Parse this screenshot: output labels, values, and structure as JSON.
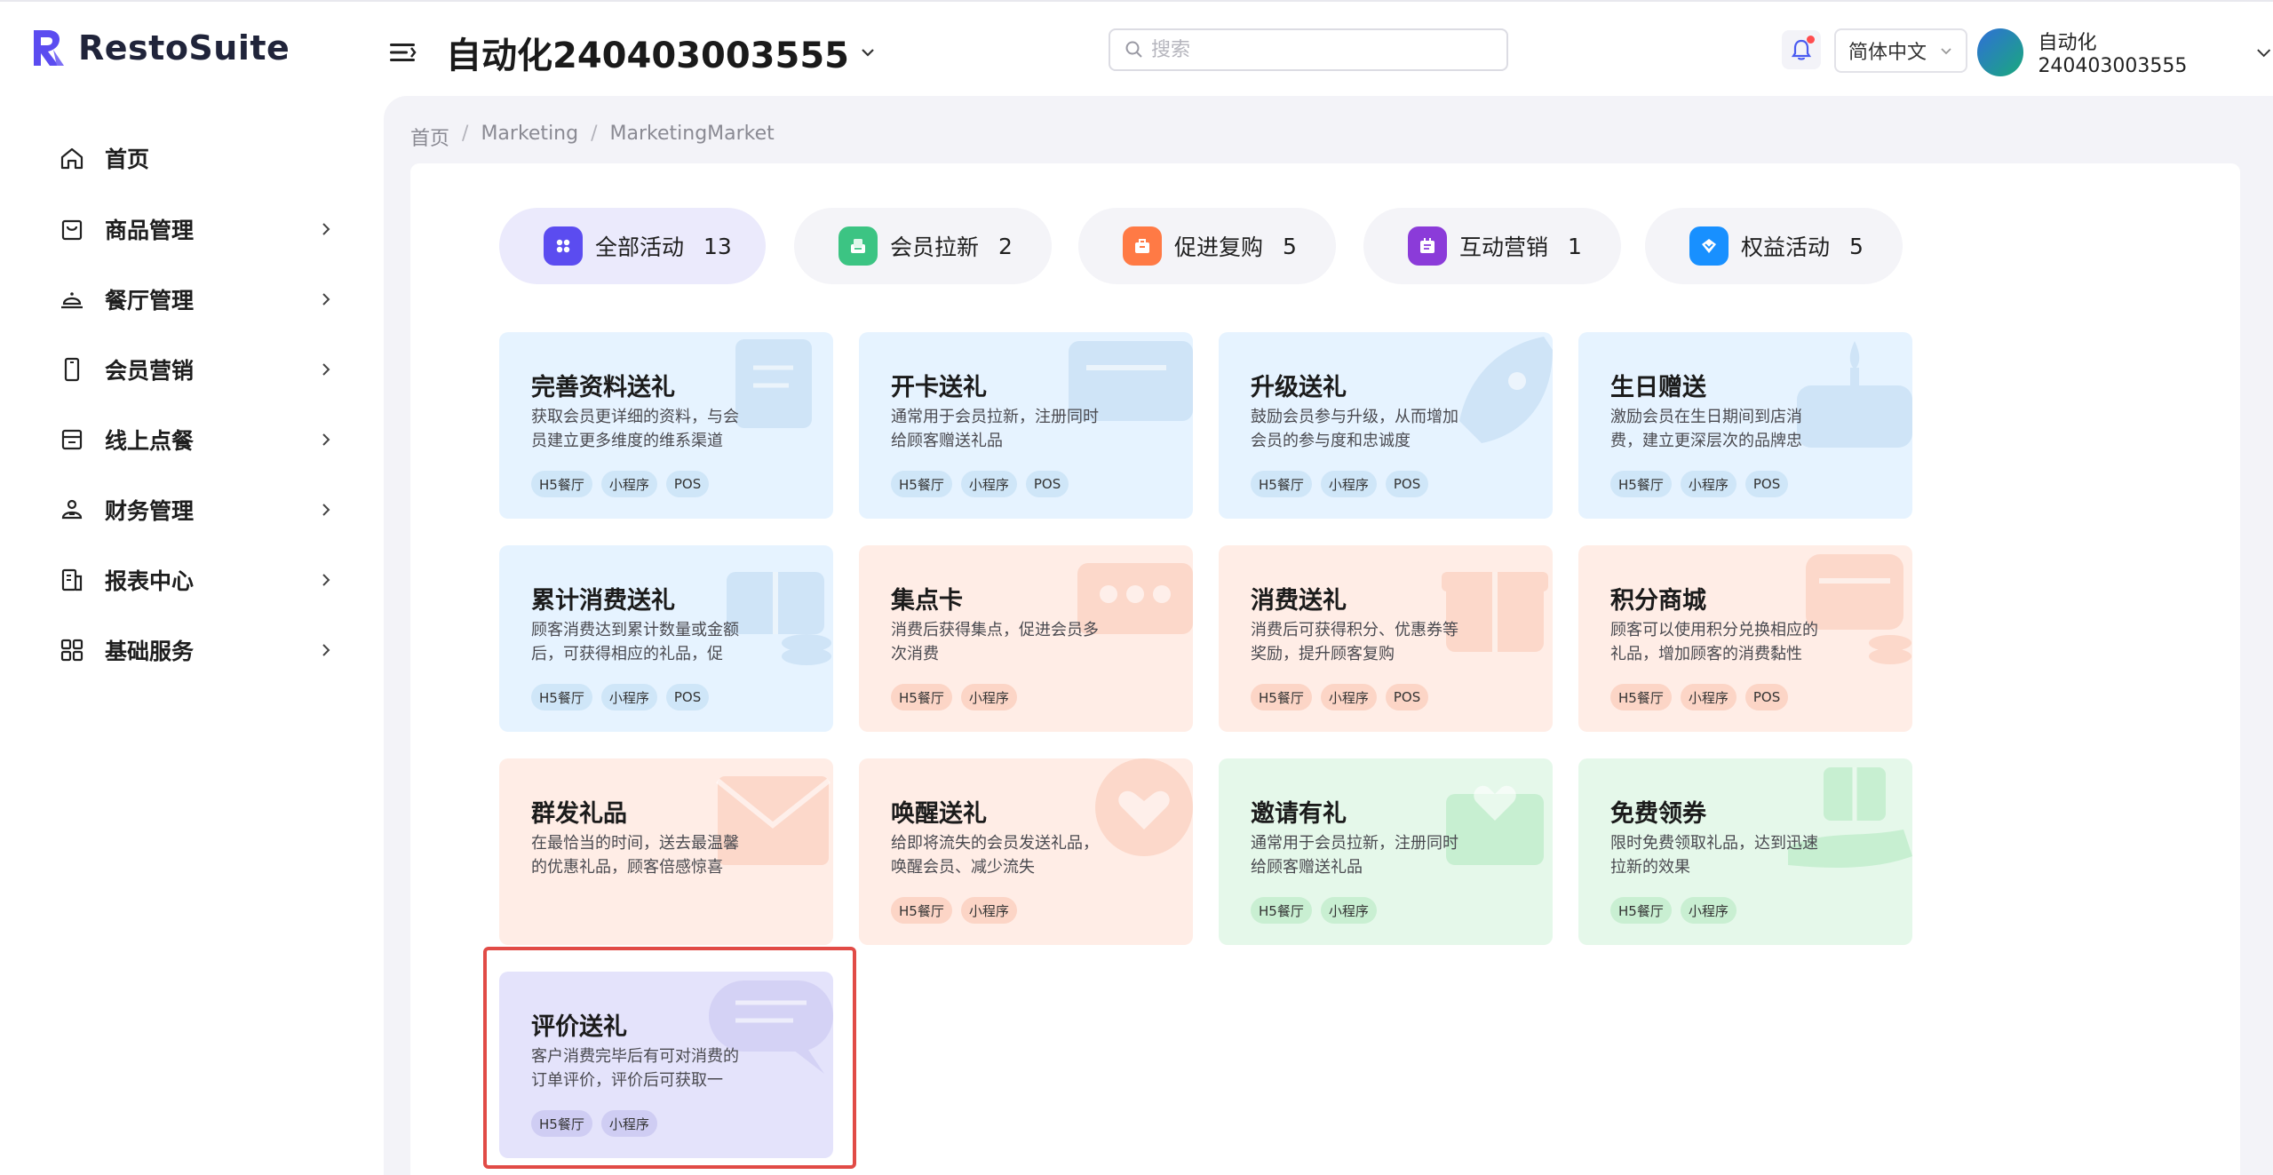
{
  "brand": {
    "name": "RestoSuite"
  },
  "header": {
    "store_name": "自动化240403003555",
    "search_placeholder": "搜索",
    "language": "简体中文",
    "user_name": "自动化240403003555"
  },
  "sidebar": {
    "items": [
      {
        "label": "首页",
        "icon": "home-icon",
        "has_arrow": false
      },
      {
        "label": "商品管理",
        "icon": "product-bag-icon",
        "has_arrow": true
      },
      {
        "label": "餐厅管理",
        "icon": "restaurant-bell-icon",
        "has_arrow": true
      },
      {
        "label": "会员营销",
        "icon": "member-card-icon",
        "has_arrow": true
      },
      {
        "label": "线上点餐",
        "icon": "online-order-icon",
        "has_arrow": true
      },
      {
        "label": "财务管理",
        "icon": "finance-icon",
        "has_arrow": true
      },
      {
        "label": "报表中心",
        "icon": "report-icon",
        "has_arrow": true
      },
      {
        "label": "基础服务",
        "icon": "grid-services-icon",
        "has_arrow": true
      }
    ]
  },
  "breadcrumb": [
    "首页",
    "Marketing",
    "MarketingMarket"
  ],
  "tabs": [
    {
      "label": "全部活动",
      "count": "13",
      "active": true,
      "color": "#5b4cf0",
      "icon": "all-activities-icon"
    },
    {
      "label": "会员拉新",
      "count": "2",
      "active": false,
      "color": "#3cc483",
      "icon": "member-acquire-icon"
    },
    {
      "label": "促进复购",
      "count": "5",
      "active": false,
      "color": "#ff7a45",
      "icon": "repurchase-icon"
    },
    {
      "label": "互动营销",
      "count": "1",
      "active": false,
      "color": "#8b3bd9",
      "icon": "interactive-icon"
    },
    {
      "label": "权益活动",
      "count": "5",
      "active": false,
      "color": "#1890ff",
      "icon": "benefit-icon"
    }
  ],
  "cards": [
    {
      "title": "完善资料送礼",
      "desc": "获取会员更详细的资料，与会员建立更多维度的维系渠道",
      "tags": [
        "H5餐厅",
        "小程序",
        "POS"
      ],
      "theme": "blue",
      "deco": "edit-document-icon"
    },
    {
      "title": "开卡送礼",
      "desc": "通常用于会员拉新，注册同时给顾客赠送礼品",
      "tags": [
        "H5餐厅",
        "小程序",
        "POS"
      ],
      "theme": "blue",
      "deco": "card-icon"
    },
    {
      "title": "升级送礼",
      "desc": "鼓励会员参与升级，从而增加会员的参与度和忠诚度",
      "tags": [
        "H5餐厅",
        "小程序",
        "POS"
      ],
      "theme": "blue",
      "deco": "rocket-icon"
    },
    {
      "title": "生日赠送",
      "desc": "激励会员在生日期间到店消费，建立更深层次的品牌忠诚...",
      "tags": [
        "H5餐厅",
        "小程序",
        "POS"
      ],
      "theme": "blue",
      "deco": "cake-icon"
    },
    {
      "title": "累计消费送礼",
      "desc": "顾客消费达到累计数量或金额后，可获得相应的礼品，促进...",
      "tags": [
        "H5餐厅",
        "小程序",
        "POS"
      ],
      "theme": "blue",
      "deco": "gift-coins-icon"
    },
    {
      "title": "集点卡",
      "desc": "消费后获得集点，促进会员多次消费",
      "tags": [
        "H5餐厅",
        "小程序"
      ],
      "theme": "peach",
      "deco": "stamp-card-icon"
    },
    {
      "title": "消费送礼",
      "desc": "消费后可获得积分、优惠券等奖励，提升顾客复购",
      "tags": [
        "H5餐厅",
        "小程序",
        "POS"
      ],
      "theme": "peach",
      "deco": "gift-box-icon"
    },
    {
      "title": "积分商城",
      "desc": "顾客可以使用积分兑换相应的礼品，增加顾客的消费黏性",
      "tags": [
        "H5餐厅",
        "小程序",
        "POS"
      ],
      "theme": "peach",
      "deco": "shop-coins-icon"
    },
    {
      "title": "群发礼品",
      "desc": "在最恰当的时间，送去最温馨的优惠礼品，顾客倍感惊喜",
      "tags": [],
      "theme": "peach",
      "deco": "envelope-icon"
    },
    {
      "title": "唤醒送礼",
      "desc": "给即将流失的会员发送礼品，唤醒会员、减少流失",
      "tags": [
        "H5餐厅",
        "小程序"
      ],
      "theme": "peach",
      "deco": "heart-bubble-icon"
    },
    {
      "title": "邀请有礼",
      "desc": "通常用于会员拉新，注册同时给顾客赠送礼品",
      "tags": [
        "H5餐厅",
        "小程序"
      ],
      "theme": "green",
      "deco": "heart-envelope-icon"
    },
    {
      "title": "免费领券",
      "desc": "限时免费领取礼品，达到迅速拉新的效果",
      "tags": [
        "H5餐厅",
        "小程序"
      ],
      "theme": "green",
      "deco": "gift-hand-icon"
    },
    {
      "title": "评价送礼",
      "desc": "客户消费完毕后有可对消费的订单评价，评价后可获取一定...",
      "tags": [
        "H5餐厅",
        "小程序"
      ],
      "theme": "purple",
      "deco": "chat-bubble-icon"
    }
  ]
}
